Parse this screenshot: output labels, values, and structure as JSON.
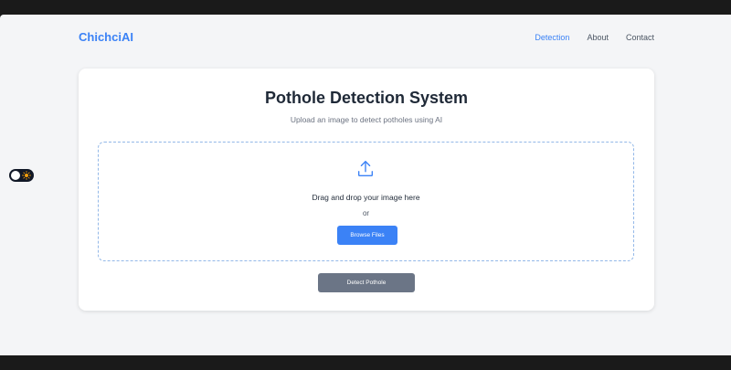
{
  "navbar": {
    "brand": "ChichciAI",
    "links": [
      {
        "label": "Detection",
        "active": true
      },
      {
        "label": "About",
        "active": false
      },
      {
        "label": "Contact",
        "active": false
      }
    ]
  },
  "theme_toggle": {
    "icon": "sun-icon",
    "state": "dark"
  },
  "main": {
    "title": "Pothole Detection System",
    "subtitle": "Upload an image to detect potholes using AI",
    "dropzone": {
      "icon": "upload-icon",
      "prompt": "Drag and drop your image here",
      "or": "or",
      "browse_label": "Browse Files"
    },
    "detect_label": "Detect Pothole"
  },
  "colors": {
    "accent": "#3b82f6",
    "heading": "#1f2937",
    "muted": "#6b7280",
    "disabled_button": "#6b7586",
    "page_bg": "#f4f5f7"
  }
}
